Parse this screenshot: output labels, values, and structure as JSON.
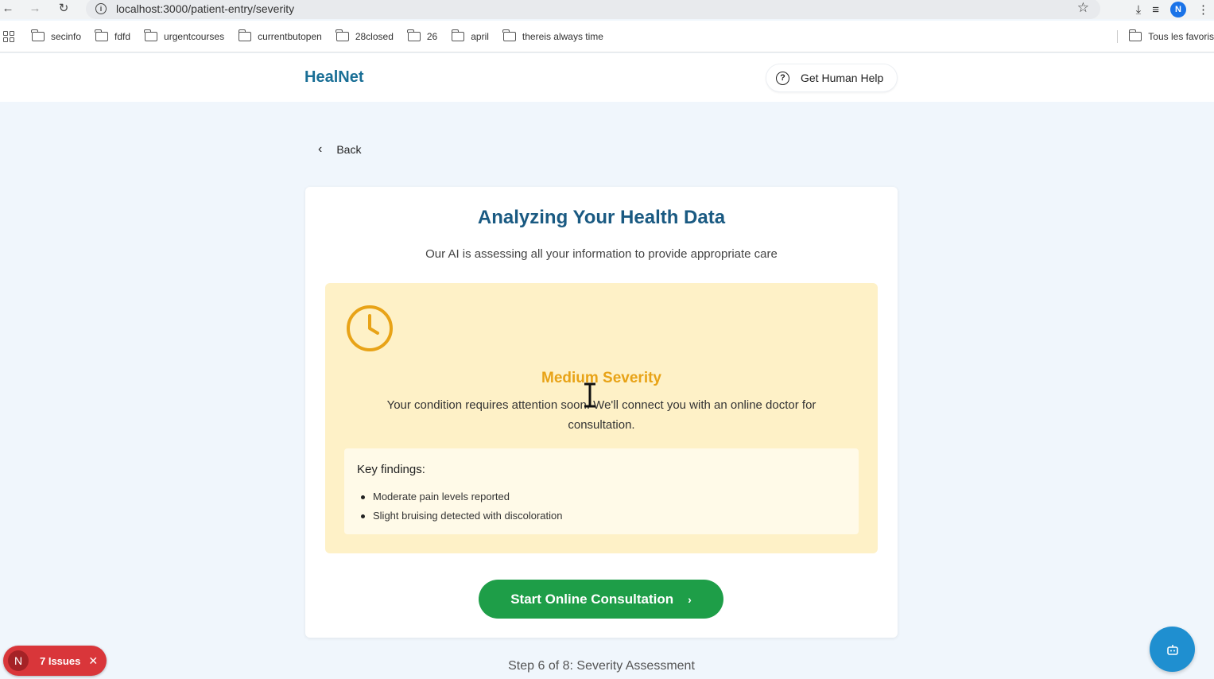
{
  "browser": {
    "url": "localhost:3000/patient-entry/severity",
    "profile_initial": "N",
    "bookmarks": [
      "secinfo",
      "fdfd",
      "urgentcourses",
      "currentbutopen",
      "28closed",
      "26",
      "april",
      "thereis always time"
    ],
    "all_bookmarks_label": "Tous les favoris"
  },
  "header": {
    "logo": "HealNet",
    "help_label": "Get Human Help"
  },
  "back_label": "Back",
  "card": {
    "title": "Analyzing Your Health Data",
    "subtitle": "Our AI is assessing all your information to provide appropriate care",
    "severity": {
      "label": "Medium Severity",
      "description": "Your condition requires attention soon. We'll connect you with an online doctor for consultation.",
      "findings_title": "Key findings:",
      "findings": [
        "Moderate pain levels reported",
        "Slight bruising detected with discoloration"
      ]
    },
    "cta_label": "Start Online Consultation"
  },
  "step_text": "Step 6 of 8: Severity Assessment",
  "issues": {
    "initial": "N",
    "label": "7 Issues"
  },
  "colors": {
    "brand": "#1a6f96",
    "severity_medium": "#e8a317",
    "cta": "#1e9e48",
    "issues": "#d9363a"
  }
}
